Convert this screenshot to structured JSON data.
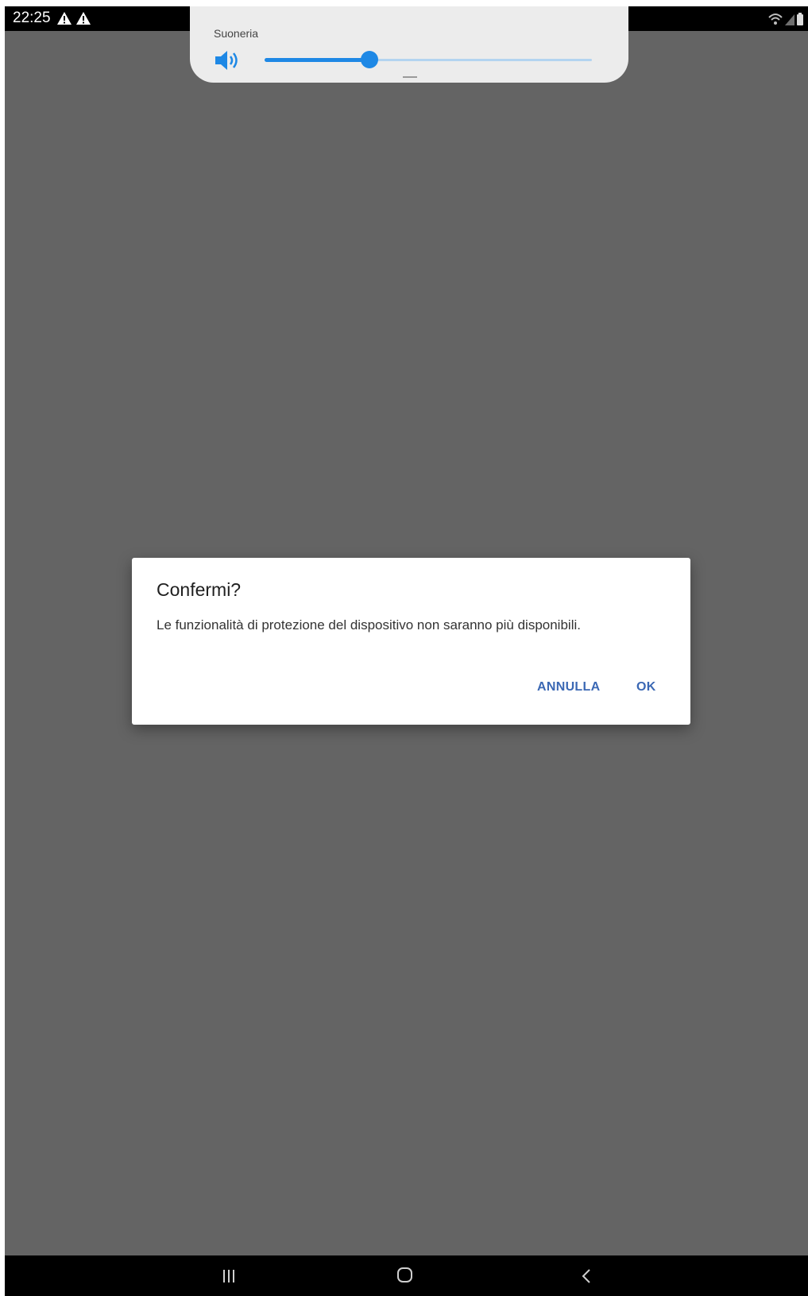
{
  "status_bar": {
    "time": "22:25",
    "notification_icons": [
      "warning-icon",
      "warning-icon"
    ],
    "system_icons": [
      "wifi-icon",
      "signal-icon",
      "battery-icon"
    ]
  },
  "volume_panel": {
    "label": "Suoneria",
    "icon": "speaker-icon",
    "level": 0.32,
    "accent_color": "#1e88e5"
  },
  "dialog": {
    "title": "Confermi?",
    "message": "Le funzionalità di protezione del dispositivo non saranno più disponibili.",
    "cancel_label": "ANNULLA",
    "ok_label": "OK",
    "button_color": "#3b68b4"
  },
  "nav_bar": {
    "buttons": [
      "recents-icon",
      "home-icon",
      "back-icon"
    ]
  }
}
